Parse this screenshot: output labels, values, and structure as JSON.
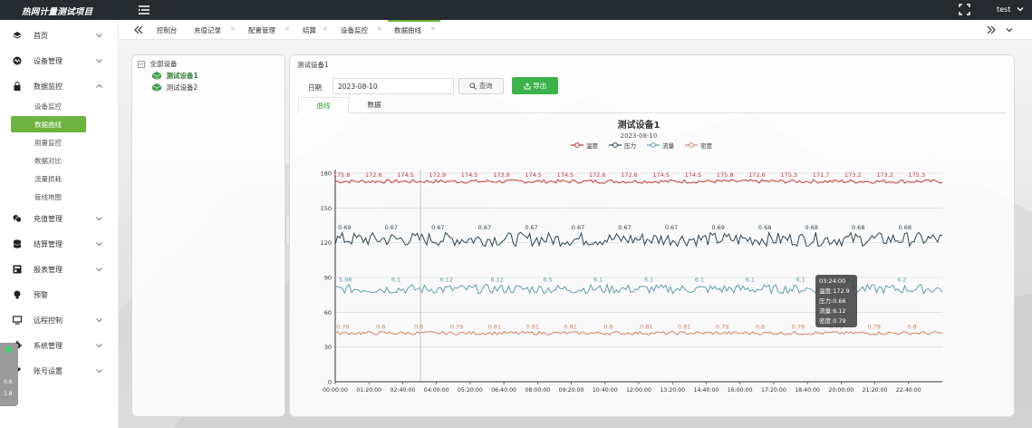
{
  "header": {
    "app_title": "热网计量测试项目",
    "user_name": "test"
  },
  "sidebar": {
    "items": [
      {
        "label": "首页",
        "icon": "layers-icon"
      },
      {
        "label": "设备管理",
        "icon": "activity-icon"
      },
      {
        "label": "数据监控",
        "icon": "lock-icon",
        "expanded": true
      },
      {
        "label": "充值管理",
        "icon": "coins-icon"
      },
      {
        "label": "结算管理",
        "icon": "database-icon"
      },
      {
        "label": "报表管理",
        "icon": "report-icon"
      },
      {
        "label": "预警",
        "icon": "bulb-icon"
      },
      {
        "label": "远程控制",
        "icon": "monitor-icon"
      },
      {
        "label": "系统管理",
        "icon": "gear-icon"
      },
      {
        "label": "账号设置",
        "icon": "pen-icon"
      }
    ],
    "sub_items": [
      {
        "label": "设备监控"
      },
      {
        "label": "数据曲线",
        "active": true
      },
      {
        "label": "用量监控"
      },
      {
        "label": "数据对比"
      },
      {
        "label": "流量损耗"
      },
      {
        "label": "管线地图"
      }
    ]
  },
  "tabs": [
    {
      "label": "控制台",
      "closable": false
    },
    {
      "label": "充值记录",
      "closable": true
    },
    {
      "label": "配置管理",
      "closable": true
    },
    {
      "label": "结算",
      "closable": true
    },
    {
      "label": "设备监控",
      "closable": true
    },
    {
      "label": "数据曲线",
      "closable": true,
      "active": true
    }
  ],
  "tree": {
    "root": "全部设备",
    "devices": [
      {
        "label": "测试设备1",
        "selected": true
      },
      {
        "label": "测试设备2"
      }
    ]
  },
  "panel": {
    "title": "测试设备1",
    "date_label": "日期",
    "date_value": "2023-08-10",
    "query_button": "查询",
    "export_button": "导出",
    "view_tabs": [
      {
        "label": "曲线",
        "active": true
      },
      {
        "label": "数据"
      }
    ]
  },
  "float_widget": {
    "line1": "0.6",
    "line2": "1.8"
  },
  "colors": {
    "accent": "#6cb33f",
    "topbar": "#262b30",
    "temp": "#c23531",
    "pressure": "#2f4554",
    "flow": "#61a0a8",
    "density": "#d48265"
  },
  "chart_data": {
    "type": "line",
    "title": "测试设备1",
    "subtitle": "2023-08-10",
    "legend_position": "top-center",
    "ylim": [
      0,
      180
    ],
    "y_ticks": [
      0,
      30,
      60,
      90,
      120,
      150,
      180
    ],
    "x_ticks": [
      "00:00:00",
      "01:20:00",
      "02:40:00",
      "04:00:00",
      "05:20:00",
      "06:40:00",
      "08:00:00",
      "09:20:00",
      "10:40:00",
      "12:00:00",
      "13:20:00",
      "14:40:00",
      "16:00:00",
      "17:20:00",
      "18:40:00",
      "20:00:00",
      "21:20:00",
      "22:40:00"
    ],
    "series": [
      {
        "name": "温度",
        "color": "#c23531",
        "base": 172.9,
        "amp": 1.6,
        "labels": [
          "175.8",
          "172.6",
          "174.5",
          "172.9",
          "174.5",
          "173.9",
          "174.5",
          "174.5",
          "172.6",
          "172.6",
          "174.5",
          "174.5",
          "175.8",
          "172.6",
          "175.3",
          "171.7",
          "173.2",
          "173.2",
          "175.3"
        ]
      },
      {
        "name": "压力",
        "color": "#2f4554",
        "base": 123,
        "amp": 6,
        "labels": [
          "0.69",
          "0.67",
          "0.67",
          "0.67",
          "0.67",
          "0.67",
          "0.67",
          "0.67",
          "0.69",
          "0.68",
          "0.68",
          "0.68",
          "0.68"
        ]
      },
      {
        "name": "流量",
        "color": "#61a0a8",
        "base": 80,
        "amp": 4,
        "labels": [
          "5.98",
          "6.1",
          "6.12",
          "6.12",
          "6.5",
          "6.1",
          "6.1",
          "6.1",
          "6.1",
          "6.1",
          "6.2",
          "6.2"
        ]
      },
      {
        "name": "密度",
        "color": "#d48265",
        "base": 42,
        "amp": 1.5,
        "labels": [
          "0.79",
          "0.8",
          "0.8",
          "0.79",
          "0.81",
          "0.81",
          "0.81",
          "0.8",
          "0.81",
          "0.81",
          "0.79",
          "0.8",
          "0.79",
          "0.79",
          "0.79",
          "0.8"
        ]
      }
    ],
    "tooltip": {
      "time": "03:24:00",
      "lines": [
        "温度:172.9",
        "压力:0.66",
        "流量:6.12",
        "密度:0.79"
      ]
    }
  }
}
